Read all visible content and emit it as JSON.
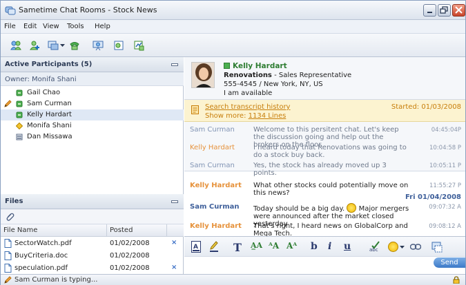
{
  "window": {
    "title": "Sametime Chat Rooms - Stock News"
  },
  "menu": [
    "File",
    "Edit",
    "View",
    "Tools",
    "Help"
  ],
  "participants": {
    "header": "Active Participants (5)",
    "owner": "Owner: Monifa Shani",
    "list": [
      {
        "name": "Gail Chao",
        "status": "available"
      },
      {
        "name": "Sam Curman",
        "status": "available",
        "typing": true
      },
      {
        "name": "Kelly Hardart",
        "status": "available",
        "selected": true
      },
      {
        "name": "Monifa Shani",
        "status": "away"
      },
      {
        "name": "Dan Missawa",
        "status": "in-meeting"
      }
    ]
  },
  "files": {
    "header": "Files",
    "col_name": "File Name",
    "col_posted": "Posted",
    "list": [
      {
        "name": "SectorWatch.pdf",
        "posted": "01/02/2008",
        "remove": "×"
      },
      {
        "name": "BuyCriteria.doc",
        "posted": "01/02/2008",
        "remove": ""
      },
      {
        "name": "speculation.pdf",
        "posted": "01/02/2008",
        "remove": "×"
      }
    ]
  },
  "profile": {
    "name": "Kelly Hardart",
    "company": "Renovations",
    "role": " - Sales Representative",
    "contact": "555-4545 / New York, NY, US",
    "status": "I am available"
  },
  "transcript": {
    "search": "Search transcript history",
    "show_more_prefix": "Show more: ",
    "show_more_link": "1134 Lines",
    "started": "Started: 01/03/2008"
  },
  "history": [
    {
      "who": "Sam Curman",
      "text": "Welcome to this persitent chat. Let's keep the discussion going and help out the brokers on the floor.",
      "time": "04:45:04P"
    },
    {
      "who": "Kelly Hardart",
      "text": "I heard today that Renovations was going to do a stock buy back.",
      "time": "10:04:58 P"
    },
    {
      "who": "Sam Curman",
      "text": "Yes, the stock has already moved up 3 points.",
      "time": "10:05:11 P"
    }
  ],
  "live": [
    {
      "who": "Kelly Hardart",
      "text": "What other stocks could potentially move on this news?",
      "time": "11:55:27 P"
    },
    {
      "who": "Sam Curman",
      "text_before": "Today should be a big day.",
      "text_after": " Major mergers were announced after the market closed yesterday",
      "time": "09:07:32 A"
    },
    {
      "who": "Kelly Hardart",
      "text": "That's right, I heard news on GlobalCorp and Mega Tech.",
      "time": "09:08:12 A"
    }
  ],
  "date_separator": "Fri 01/04/2008",
  "composer": {
    "send": "Send"
  },
  "status_bar": {
    "text": "Sam Curman is typing..."
  }
}
